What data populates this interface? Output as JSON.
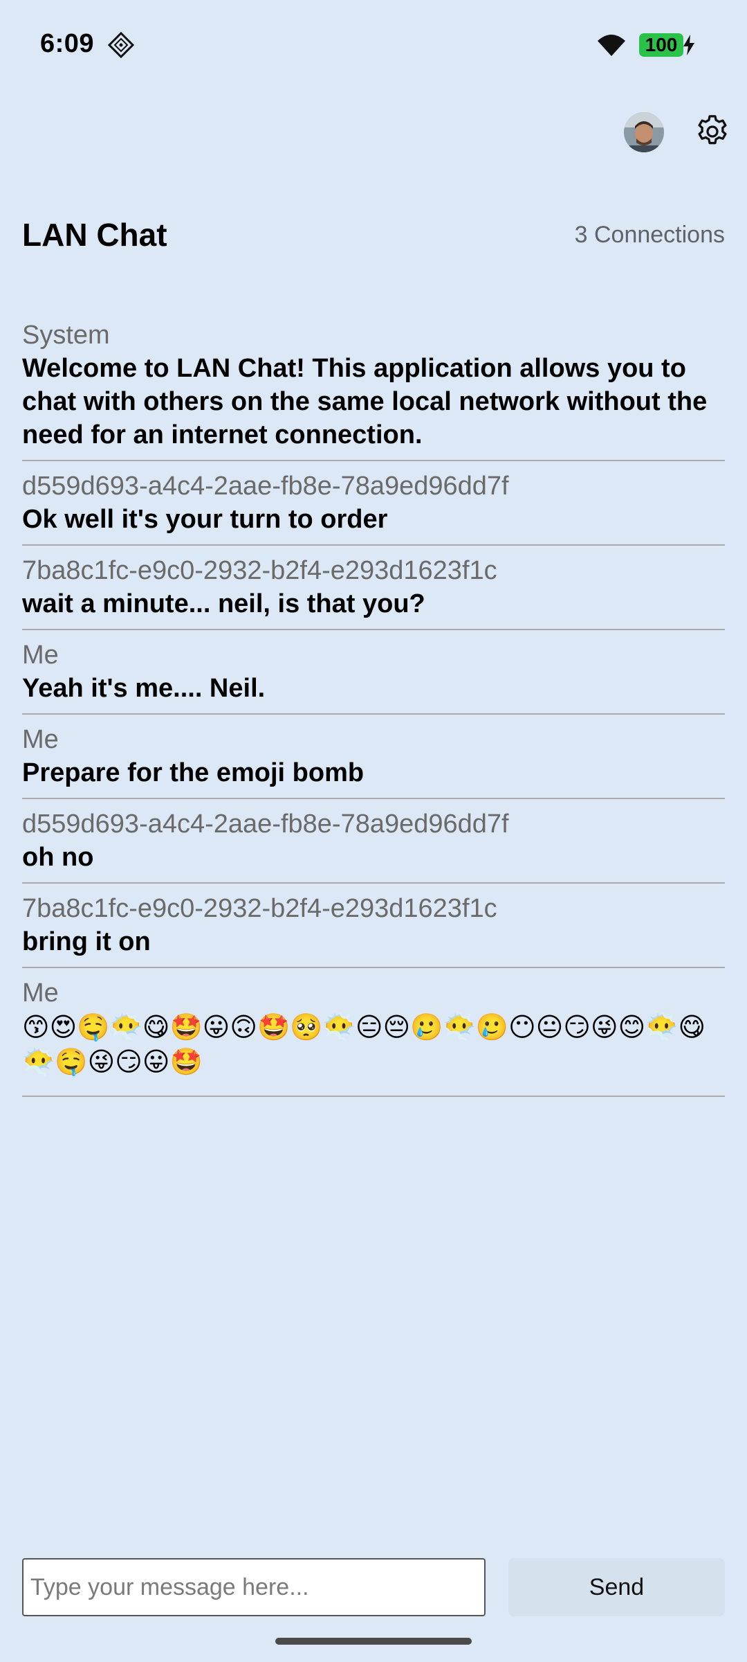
{
  "status_bar": {
    "time": "6:09",
    "battery": "100"
  },
  "header": {
    "title": "LAN Chat",
    "connections": "3 Connections"
  },
  "icons": {
    "avatar": "avatar",
    "settings": "gear-icon",
    "wifi": "wifi-icon",
    "charging": "charging-icon",
    "app_status": "app-status-icon"
  },
  "messages": [
    {
      "sender": "System",
      "text": "Welcome to LAN Chat! This application allows you to chat with others on the same local network without the need for an internet connection."
    },
    {
      "sender": "d559d693-a4c4-2aae-fb8e-78a9ed96dd7f",
      "text": "Ok well it's your turn to order"
    },
    {
      "sender": "7ba8c1fc-e9c0-2932-b2f4-e293d1623f1c",
      "text": "wait a minute... neil, is that you?"
    },
    {
      "sender": "Me",
      "text": "Yeah it's me.... Neil."
    },
    {
      "sender": "Me",
      "text": "Prepare for the emoji bomb"
    },
    {
      "sender": "d559d693-a4c4-2aae-fb8e-78a9ed96dd7f",
      "text": "oh no"
    },
    {
      "sender": "7ba8c1fc-e9c0-2932-b2f4-e293d1623f1c",
      "text": "bring it on"
    },
    {
      "sender": "Me",
      "text": "😙😍🤤😶‍🌫️😋🤩😛🙃🤩🥺😶‍🌫️😑😔🥲😶‍🌫️🥲😶😐😏😜😊😶‍🌫️😋😶‍🌫️🤤😜😏😛🤩",
      "is_emoji": true
    }
  ],
  "composer": {
    "placeholder": "Type your message here...",
    "value": "",
    "send_label": "Send"
  },
  "colors": {
    "background": "#dce8f6",
    "battery": "#2bc24a",
    "send_button": "#d6e1ee",
    "divider": "#a9a9a9"
  }
}
